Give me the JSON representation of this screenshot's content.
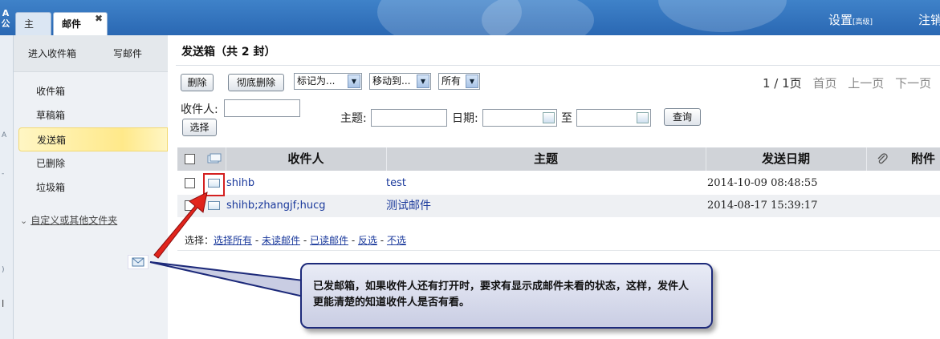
{
  "header": {
    "brand": "A公",
    "tabs": [
      {
        "label": "主页"
      },
      {
        "label": "邮件",
        "close": "✖"
      }
    ],
    "settings_label": "设置",
    "settings_small": "[高级]",
    "logout_label": "注销"
  },
  "sidebar": {
    "actions": {
      "inbox": "进入收件箱",
      "compose": "写邮件"
    },
    "folders": [
      {
        "label": "收件箱",
        "active": false
      },
      {
        "label": "草稿箱",
        "active": false
      },
      {
        "label": "发送箱",
        "active": true
      },
      {
        "label": "已删除",
        "active": false
      },
      {
        "label": "垃圾箱",
        "active": false
      }
    ],
    "custom_folders_label": "自定义或其他文件夹"
  },
  "main": {
    "title": "发送箱（共 2 封）",
    "toolbar": {
      "delete": "删除",
      "delete_permanently": "彻底删除",
      "mark_as": "标记为...",
      "move_to": "移动到...",
      "filter": "所有"
    },
    "pager": {
      "status": "1 / 1页",
      "first": "首页",
      "prev": "上一页",
      "next": "下一页"
    },
    "search": {
      "recipient_label": "收件人:",
      "select_button": "选择",
      "subject_label": "主题:",
      "date_label": "日期:",
      "to_label": "至",
      "query_button": "查询"
    },
    "table": {
      "headers": {
        "recipient": "收件人",
        "subject": "主题",
        "sent_date": "发送日期",
        "attachment": "附件"
      },
      "rows": [
        {
          "recipient": "shihb",
          "subject": "test",
          "date": "2014-10-09 08:48:55"
        },
        {
          "recipient": "shihb;zhangjf;hucg",
          "subject": "测试邮件",
          "date": "2014-08-17 15:39:17"
        }
      ]
    },
    "select_bar": {
      "prefix": "选择：",
      "all": "选择所有",
      "unread": "未读邮件",
      "read": "已读邮件",
      "invert": "反选",
      "none": "不选",
      "sep": " - "
    }
  },
  "callout": {
    "text": "已发邮箱，如果收件人还有打开时，要求有显示成邮件未看的状态，这样，发件人更能清楚的知道收件人是否有看。"
  },
  "colors": {
    "header_blue": "#2f72bd",
    "link_blue": "#1b3a9c",
    "highlight_red": "#d42020",
    "callout_border": "#1d2a7a"
  }
}
